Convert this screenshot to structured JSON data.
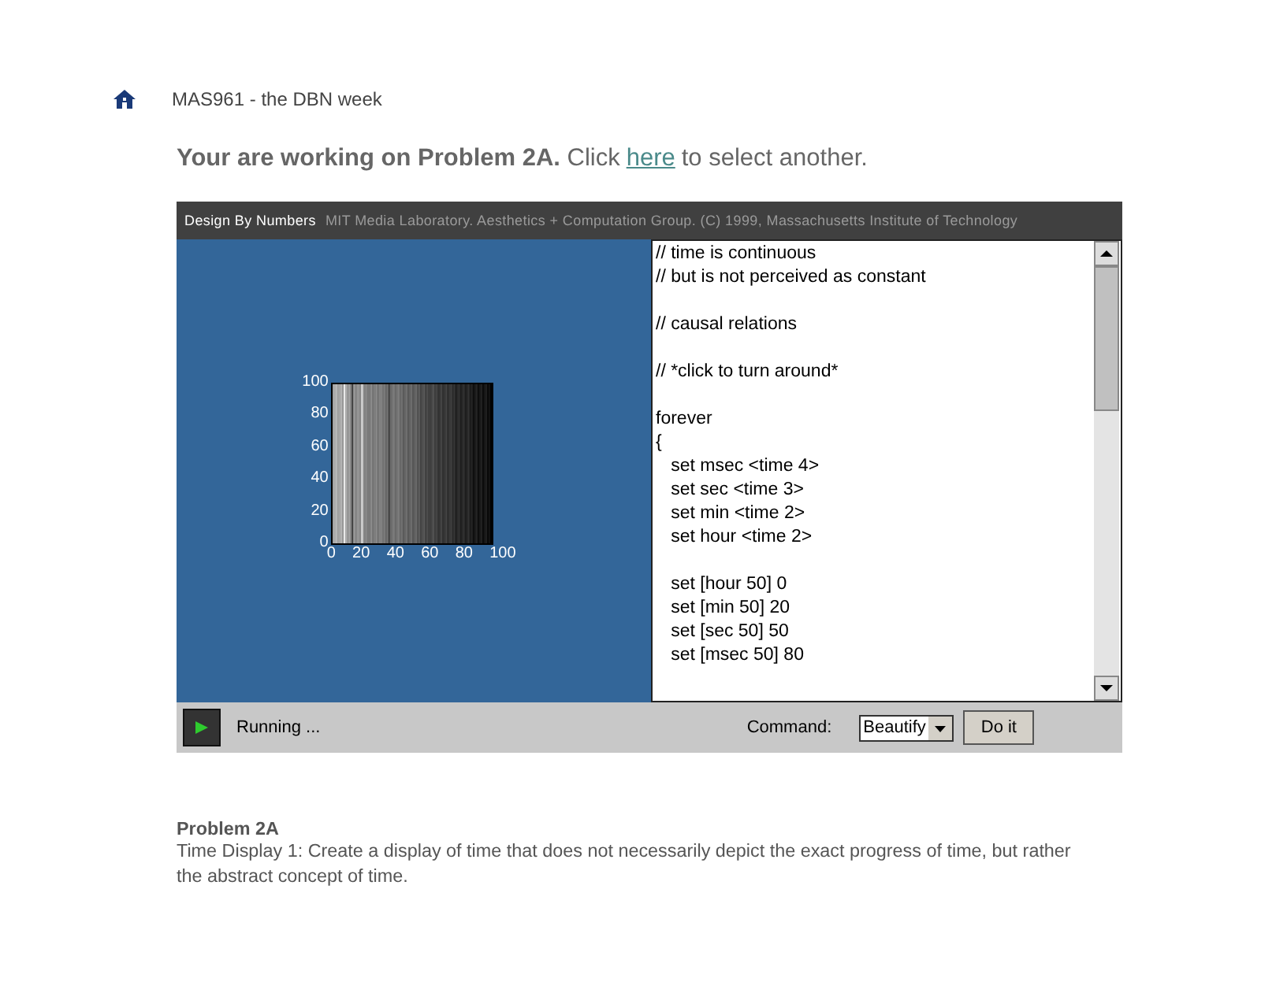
{
  "breadcrumb": {
    "title": "MAS961 - the DBN week"
  },
  "heading": {
    "text": "**Your are working on Problem 2A.** Click",
    "link": "here",
    "after": "to select another."
  },
  "applet": {
    "title": "Design By Numbers",
    "credit": "MIT Media Laboratory. Aesthetics + Computation Group. (C) 1999, Massachusetts Institute of Technology",
    "canvas": {
      "y_ticks": [
        "100",
        "80",
        "60",
        "40",
        "20",
        "0"
      ],
      "x_ticks": [
        "0",
        "20",
        "40",
        "60",
        "80",
        "100"
      ]
    },
    "code": "// time is continuous\n// but is not perceived as constant\n\n// causal relations\n\n// *click to turn around*\n\nforever\n{\n   set msec <time 4>\n   set sec <time 3>\n   set min <time 2>\n   set hour <time 2>\n\n   set [hour 50] 0\n   set [min 50] 20\n   set [sec 50] 50\n   set [msec 50] 80",
    "status": "Running ...",
    "command_label": "Command:",
    "command_value": "Beautify",
    "run_button": "Do it"
  },
  "problem": {
    "title": "Problem 2A",
    "description": "Time Display 1: Create a display of time that does not necessarily depict the exact progress of time, but rather the abstract concept of time."
  }
}
